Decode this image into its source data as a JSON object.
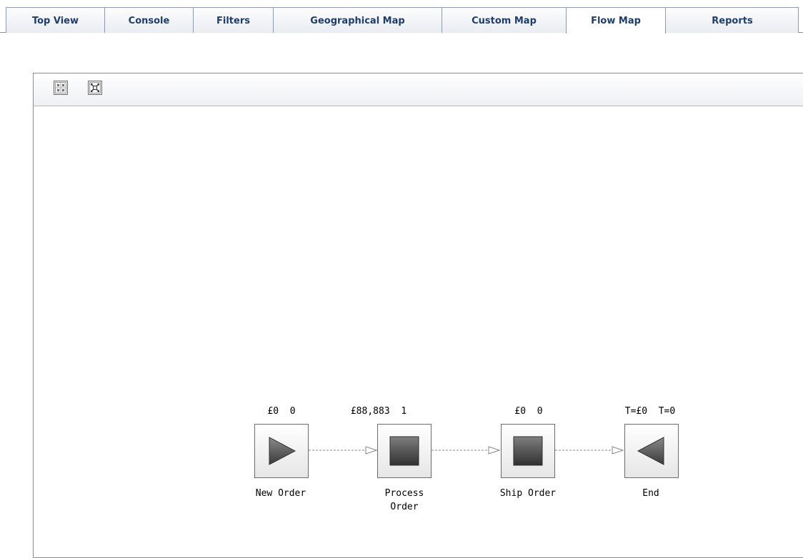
{
  "tabs": [
    {
      "label": "Top View",
      "active": false
    },
    {
      "label": "Console",
      "active": false
    },
    {
      "label": "Filters",
      "active": false
    },
    {
      "label": "Geographical Map",
      "active": false
    },
    {
      "label": "Custom Map",
      "active": false
    },
    {
      "label": "Flow Map",
      "active": true
    },
    {
      "label": "Reports",
      "active": false
    }
  ],
  "toolbar": {
    "buttons": [
      {
        "icon": "collapse-all-icon"
      },
      {
        "icon": "expand-all-icon"
      }
    ]
  },
  "flow": {
    "nodes": [
      {
        "metric_value": "£0",
        "metric_count": "0",
        "label_line1": "New Order",
        "label_line2": "",
        "icon": "start-play-icon"
      },
      {
        "metric_value": "£88,883",
        "metric_count": "1",
        "label_line1": "Process",
        "label_line2": "Order",
        "icon": "stop-square-icon"
      },
      {
        "metric_value": "£0",
        "metric_count": "0",
        "label_line1": "Ship Order",
        "label_line2": "",
        "icon": "stop-square-icon"
      },
      {
        "metric_value": "T=£0",
        "metric_count": "T=0",
        "label_line1": "End",
        "label_line2": "",
        "icon": "end-reverse-icon"
      }
    ]
  },
  "colors": {
    "tab_text": "#1f3d6b",
    "node_fill_dark": "#3a3a3a",
    "node_fill_mid": "#7a7a7a"
  }
}
